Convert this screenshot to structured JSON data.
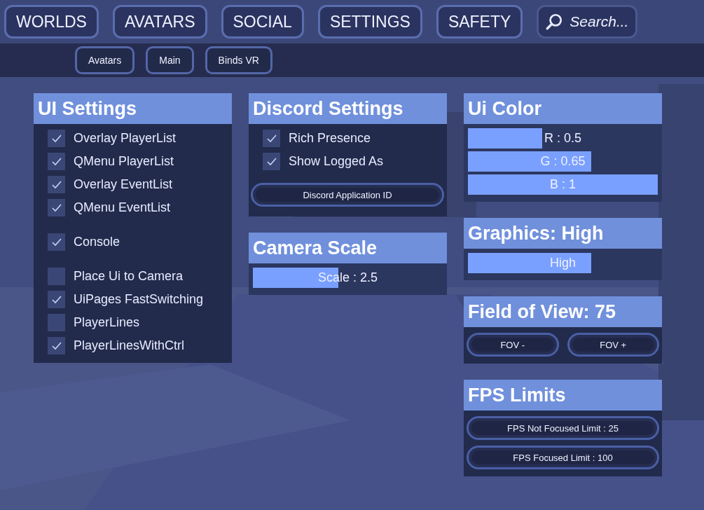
{
  "top_tabs": [
    {
      "label": "WORLDS"
    },
    {
      "label": "AVATARS"
    },
    {
      "label": "SOCIAL"
    },
    {
      "label": "SETTINGS"
    },
    {
      "label": "SAFETY"
    }
  ],
  "search": {
    "placeholder": "Search..."
  },
  "sub_tabs": [
    {
      "label": "Avatars"
    },
    {
      "label": "Main"
    },
    {
      "label": "Binds VR"
    }
  ],
  "ui_settings": {
    "title": "UI Settings",
    "groups": [
      [
        {
          "label": "Overlay PlayerList",
          "checked": true
        },
        {
          "label": "QMenu PlayerList",
          "checked": true
        },
        {
          "label": "Overlay EventList",
          "checked": true
        },
        {
          "label": "QMenu EventList",
          "checked": true
        }
      ],
      [
        {
          "label": "Console",
          "checked": true
        }
      ],
      [
        {
          "label": "Place Ui to Camera",
          "checked": false
        },
        {
          "label": "UiPages FastSwitching",
          "checked": true
        },
        {
          "label": "PlayerLines",
          "checked": false
        },
        {
          "label": "PlayerLinesWithCtrl",
          "checked": true
        }
      ]
    ]
  },
  "discord_settings": {
    "title": "Discord Settings",
    "options": [
      {
        "label": "Rich Presence",
        "checked": true
      },
      {
        "label": "Show Logged As",
        "checked": true
      }
    ],
    "button": "Discord Application ID"
  },
  "camera_scale": {
    "title": "Camera Scale",
    "slider": {
      "label": "Scale : 2.5",
      "level": 0.45
    }
  },
  "ui_color": {
    "title": "Ui Color",
    "sliders": [
      {
        "label": "R : 0.5",
        "level": 0.39
      },
      {
        "label": "G : 0.65",
        "level": 0.65
      },
      {
        "label": "B : 1",
        "level": 1
      }
    ]
  },
  "graphics": {
    "title": "Graphics: High",
    "slider": {
      "label": "High",
      "level": 0.65
    }
  },
  "field_of_view": {
    "title": "Field of View: 75",
    "buttons": [
      "FOV -",
      "FOV +"
    ]
  },
  "fps_limits": {
    "title": "FPS Limits",
    "buttons": [
      "FPS Not Focused Limit : 25",
      "FPS Focused Limit : 100"
    ]
  }
}
